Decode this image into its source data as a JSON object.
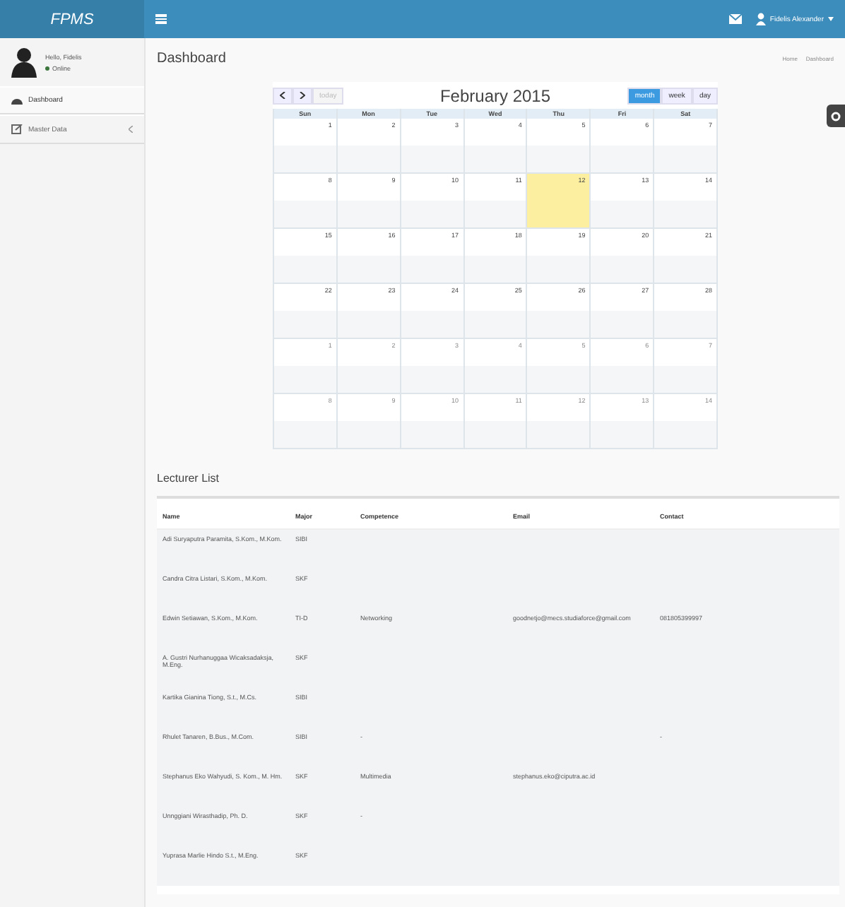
{
  "header": {
    "logo": "FPMS",
    "user": "Fidelis Alexander"
  },
  "sidebar": {
    "user_name": "Hello, Fidelis",
    "status": "Online",
    "items": [
      {
        "label": "Dashboard",
        "selected": true,
        "expandable": false
      },
      {
        "label": "Master Data",
        "selected": false,
        "expandable": true
      }
    ]
  },
  "page": {
    "title": "Dashboard",
    "breadcrumb": [
      "Home",
      "Dashboard"
    ]
  },
  "calendar": {
    "title": "February 2015",
    "today_label": "today",
    "views": [
      {
        "label": "month",
        "selected": true
      },
      {
        "label": "week",
        "selected": false
      },
      {
        "label": "day",
        "selected": false
      }
    ],
    "weekdays": [
      "Sun",
      "Mon",
      "Tue",
      "Wed",
      "Thu",
      "Fri",
      "Sat"
    ],
    "weeks": [
      [
        {
          "day": "1",
          "other": false,
          "today": false
        },
        {
          "day": "2",
          "other": false,
          "today": false
        },
        {
          "day": "3",
          "other": false,
          "today": false
        },
        {
          "day": "4",
          "other": false,
          "today": false
        },
        {
          "day": "5",
          "other": false,
          "today": false
        },
        {
          "day": "6",
          "other": false,
          "today": false
        },
        {
          "day": "7",
          "other": false,
          "today": false
        }
      ],
      [
        {
          "day": "8",
          "other": false,
          "today": false
        },
        {
          "day": "9",
          "other": false,
          "today": false
        },
        {
          "day": "10",
          "other": false,
          "today": false
        },
        {
          "day": "11",
          "other": false,
          "today": false
        },
        {
          "day": "12",
          "other": false,
          "today": true
        },
        {
          "day": "13",
          "other": false,
          "today": false
        },
        {
          "day": "14",
          "other": false,
          "today": false
        }
      ],
      [
        {
          "day": "15",
          "other": false,
          "today": false
        },
        {
          "day": "16",
          "other": false,
          "today": false
        },
        {
          "day": "17",
          "other": false,
          "today": false
        },
        {
          "day": "18",
          "other": false,
          "today": false
        },
        {
          "day": "19",
          "other": false,
          "today": false
        },
        {
          "day": "20",
          "other": false,
          "today": false
        },
        {
          "day": "21",
          "other": false,
          "today": false
        }
      ],
      [
        {
          "day": "22",
          "other": false,
          "today": false
        },
        {
          "day": "23",
          "other": false,
          "today": false
        },
        {
          "day": "24",
          "other": false,
          "today": false
        },
        {
          "day": "25",
          "other": false,
          "today": false
        },
        {
          "day": "26",
          "other": false,
          "today": false
        },
        {
          "day": "27",
          "other": false,
          "today": false
        },
        {
          "day": "28",
          "other": false,
          "today": false
        }
      ],
      [
        {
          "day": "1",
          "other": true,
          "today": false
        },
        {
          "day": "2",
          "other": true,
          "today": false
        },
        {
          "day": "3",
          "other": true,
          "today": false
        },
        {
          "day": "4",
          "other": true,
          "today": false
        },
        {
          "day": "5",
          "other": true,
          "today": false
        },
        {
          "day": "6",
          "other": true,
          "today": false
        },
        {
          "day": "7",
          "other": true,
          "today": false
        }
      ],
      [
        {
          "day": "8",
          "other": true,
          "today": false
        },
        {
          "day": "9",
          "other": true,
          "today": false
        },
        {
          "day": "10",
          "other": true,
          "today": false
        },
        {
          "day": "11",
          "other": true,
          "today": false
        },
        {
          "day": "12",
          "other": true,
          "today": false
        },
        {
          "day": "13",
          "other": true,
          "today": false
        },
        {
          "day": "14",
          "other": true,
          "today": false
        }
      ]
    ]
  },
  "lecturers": {
    "title": "Lecturer List",
    "columns": [
      "Name",
      "Major",
      "Competence",
      "Email",
      "Contact"
    ],
    "rows": [
      [
        "Adi Suryaputra Paramita, S.Kom., M.Kom.",
        "SIBI",
        "",
        "",
        ""
      ],
      [
        "Candra Citra Listari, S.Kom., M.Kom.",
        "SKF",
        "",
        "",
        ""
      ],
      [
        "Edwin Setiawan, S.Kom., M.Kom.",
        "TI-D",
        "Networking",
        "goodnetjo@mecs.studiaforce@gmail.com",
        "081805399997"
      ],
      [
        "A. Gustri Nurhanuggaa Wicaksadaksja, M.Eng.",
        "SKF",
        "",
        "",
        ""
      ],
      [
        "Kartika Gianina Tiong, S.t., M.Cs.",
        "SIBI",
        "",
        "",
        ""
      ],
      [
        "Rhulet Tanaren, B.Bus., M.Com.",
        "SIBI",
        "-",
        "",
        "-"
      ],
      [
        "Stephanus Eko Wahyudi, S. Kom., M. Hm.",
        "SKF",
        "Multimedia",
        "stephanus.eko@ciputra.ac.id",
        ""
      ],
      [
        "Unnggiani Wirasthadip, Ph. D.",
        "SKF",
        "-",
        "",
        ""
      ],
      [
        "Yuprasa Marlie Hindo S.t., M.Eng.",
        "SKF",
        "",
        "",
        ""
      ]
    ]
  }
}
